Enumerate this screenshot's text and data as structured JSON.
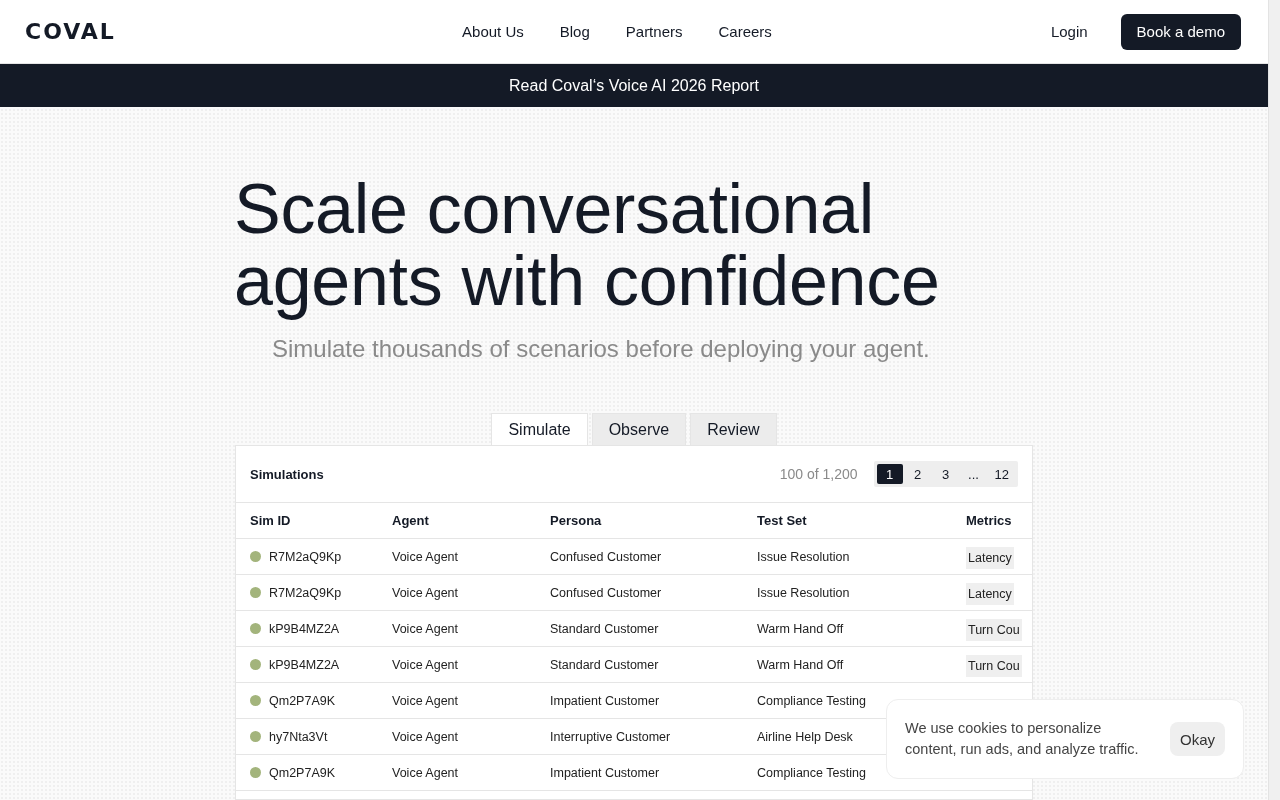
{
  "header": {
    "logo": "COVAL",
    "nav": [
      "About Us",
      "Blog",
      "Partners",
      "Careers"
    ],
    "login": "Login",
    "cta": "Book a demo"
  },
  "banner": "Read Coval‘s Voice AI 2026 Report",
  "hero": {
    "title_lines": [
      "Scale conversational",
      "agents with confidence"
    ],
    "subtitle": "Simulate thousands of scenarios before deploying your agent."
  },
  "tabs": [
    {
      "label": "Simulate",
      "selected": true
    },
    {
      "label": "Observe",
      "selected": false
    },
    {
      "label": "Review",
      "selected": false
    }
  ],
  "table": {
    "title": "Simulations",
    "count": "100 of 1,200",
    "pages": [
      {
        "label": "1",
        "selected": true
      },
      {
        "label": "2",
        "selected": false
      },
      {
        "label": "3",
        "selected": false
      },
      {
        "label": "...",
        "selected": false
      },
      {
        "label": "12",
        "selected": false
      }
    ],
    "columns": [
      "Sim ID",
      "Agent",
      "Persona",
      "Test Set",
      "Metrics"
    ],
    "rows": [
      {
        "color": "#a3b47c",
        "sim_id": "R7M2aQ9Kp",
        "agent": "Voice Agent",
        "persona": "Confused Customer",
        "test_set": "Issue Resolution",
        "metric": "Latency"
      },
      {
        "color": "#a3b47c",
        "sim_id": "R7M2aQ9Kp",
        "agent": "Voice Agent",
        "persona": "Confused Customer",
        "test_set": "Issue Resolution",
        "metric": "Latency"
      },
      {
        "color": "#a3b47c",
        "sim_id": "kP9B4MZ2A",
        "agent": "Voice Agent",
        "persona": "Standard Customer",
        "test_set": "Warm Hand Off",
        "metric": "Turn Cou"
      },
      {
        "color": "#a3b47c",
        "sim_id": "kP9B4MZ2A",
        "agent": "Voice Agent",
        "persona": "Standard Customer",
        "test_set": "Warm Hand Off",
        "metric": "Turn Cou"
      },
      {
        "color": "#a3b47c",
        "sim_id": "Qm2P7A9K",
        "agent": "Voice Agent",
        "persona": "Impatient Customer",
        "test_set": "Compliance Testing"
      },
      {
        "color": "#a3b47c",
        "sim_id": "hy7Nta3Vt",
        "agent": "Voice Agent",
        "persona": "Interruptive Customer",
        "test_set": "Airline Help Desk"
      },
      {
        "color": "#a3b47c",
        "sim_id": "Qm2P7A9K",
        "agent": "Voice Agent",
        "persona": "Impatient Customer",
        "test_set": "Compliance Testing"
      }
    ]
  },
  "cookie": {
    "text": "We use cookies to personalize content, run ads, and analyze traffic.",
    "button": "Okay"
  }
}
